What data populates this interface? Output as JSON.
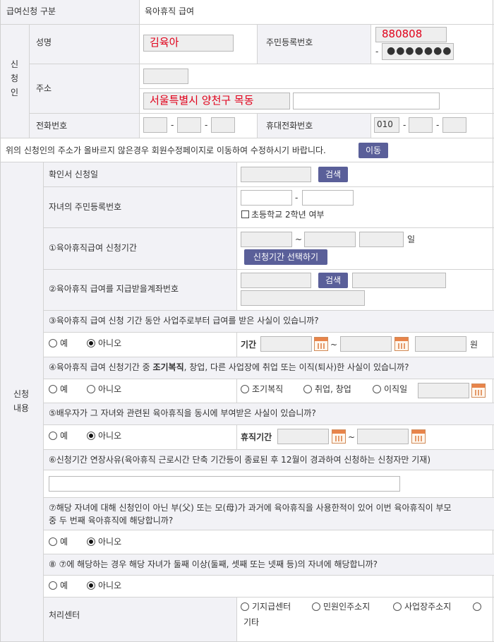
{
  "header": {
    "category_label": "급여신청 구분",
    "category_value": "육아휴직 급여"
  },
  "applicant": {
    "group_label": [
      "신",
      "청",
      "인"
    ],
    "name_label": "성명",
    "name_value": "김육아",
    "rrn_label": "주민등록번호",
    "rrn_front": "880808",
    "rrn_dash": "-",
    "rrn_back": "●●●●●●●",
    "address_label": "주소",
    "address_value": "서울특별시 양천구 목동",
    "phone_label": "전화번호",
    "mobile_label": "휴대전화번호",
    "mobile_prefix": "010",
    "dash": "-"
  },
  "notice": {
    "text": "위의 신청인의 주소가 올바르지 않은경우 회원수정페이지로 이동하여 수정하시기 바랍니다.",
    "move_button": "이동"
  },
  "content": {
    "group_label": [
      "신청",
      "내용"
    ],
    "confirm_date_label": "확인서 신청일",
    "search_button": "검색",
    "child_rrn_label": "자녀의 주민등록번호",
    "elementary_check": "초등학교 2학년 여부",
    "period_label": "①육아휴직급여 신청기간",
    "tilde": "~",
    "day_unit": "일",
    "period_button": "신청기간 선택하기",
    "account_label": "②육아휴직 급여를 지급받을계좌번호",
    "q3": "③육아휴직 급여 신청 기간 동안 사업주로부터 급여를 받은 사실이 있습니까?",
    "yes": "예",
    "no": "아니오",
    "period_short": "기간",
    "won": "원",
    "q4_pre": "④육아휴직 급여 신청기간 중 ",
    "q4_bold": "조기복직",
    "q4_post": ", 창업, 다른 사업장에 취업 또는 이직(퇴사)한 사실이 있습니까?",
    "q4_opt1": "조기복직",
    "q4_opt2": "취업, 창업",
    "q4_opt3": "이직일",
    "q5": "⑤배우자가 그 자녀와 관련된 육아휴직을 동시에 부여받은 사실이 있습니까?",
    "leave_period": "휴직기간",
    "q6": "⑥신청기간 연장사유(육아휴직 근로시간 단축 기간등이 종료된 후 12월이 경과하여 신청하는 신청자만 기재)",
    "q7_line1": "⑦해당 자녀에 대해 신청인이 아닌 부(父) 또는 모(母)가 과거에 육아휴직을 사용한적이 있어 이번 육아휴직이 부모",
    "q7_line2": "중 두 번째 육아휴직에 해당합니까?",
    "q8": "⑧ ⑦에 해당하는 경우 해당 자녀가 둘째 이상(둘째, 셋째 또는 넷째 등)의 자녀에 해당합니까?",
    "center_label": "처리센터",
    "center_opt1": "기지급센터",
    "center_opt2": "민원인주소지",
    "center_opt3": "사업장주소지",
    "center_opt4": "기타"
  }
}
